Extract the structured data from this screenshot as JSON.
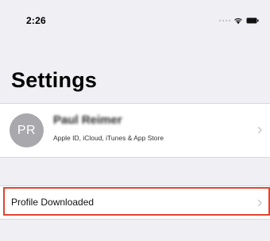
{
  "status_bar": {
    "time": "2:26"
  },
  "header": {
    "title": "Settings"
  },
  "account": {
    "initials": "PR",
    "name": "Paul Reimer",
    "subtitle": "Apple ID, iCloud, iTunes & App Store"
  },
  "profile_row": {
    "label": "Profile Downloaded"
  },
  "colors": {
    "background": "#efeff4",
    "cell_background": "#ffffff",
    "avatar": "#a8a8ad",
    "highlight": "#e3452f",
    "chevron": "#c7c7cc"
  },
  "icons": {
    "wifi": "wifi-icon",
    "battery": "battery-icon",
    "chevron": "chevron-right-icon"
  }
}
